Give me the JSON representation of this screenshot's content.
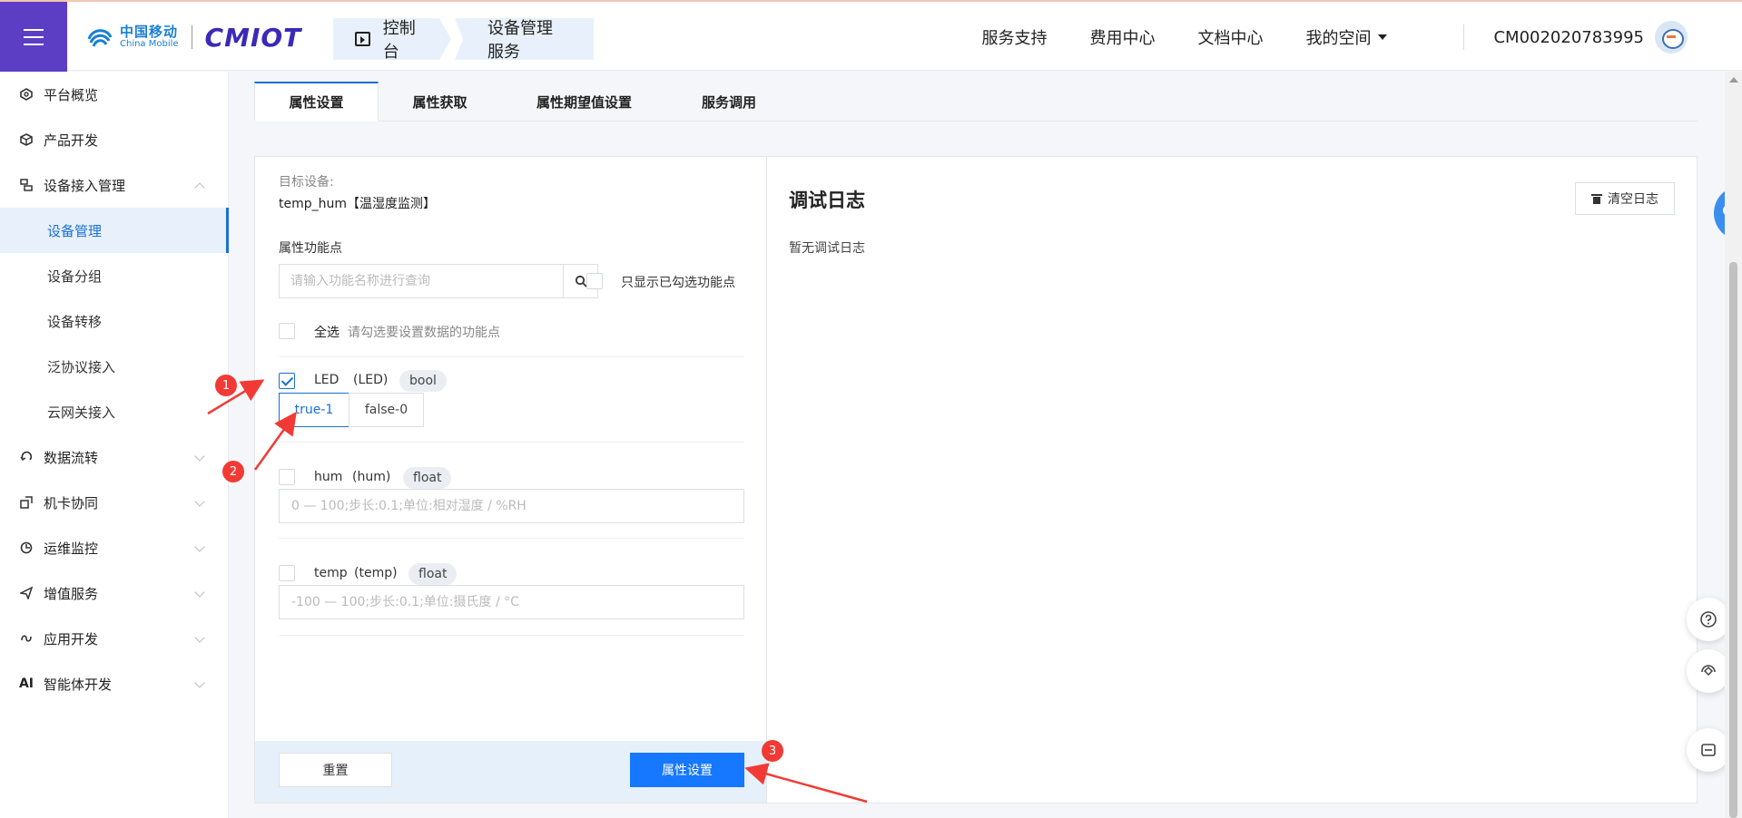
{
  "header": {
    "logo_cn": "中国移动",
    "logo_en": "China Mobile",
    "brand": "CMIOT",
    "crumbs": [
      "控制台",
      "设备管理服务"
    ],
    "nav": [
      "服务支持",
      "费用中心",
      "文档中心",
      "我的空间"
    ],
    "account": "CM002020783995"
  },
  "sidebar": {
    "items": [
      {
        "label": "平台概览",
        "icon": "overview-icon"
      },
      {
        "label": "产品开发",
        "icon": "cube-icon"
      },
      {
        "label": "设备接入管理",
        "icon": "device-access-icon"
      },
      {
        "label": "设备管理"
      },
      {
        "label": "设备分组"
      },
      {
        "label": "设备转移"
      },
      {
        "label": "泛协议接入"
      },
      {
        "label": "云网关接入"
      },
      {
        "label": "数据流转",
        "icon": "data-flow-icon"
      },
      {
        "label": "机卡协同",
        "icon": "sim-icon"
      },
      {
        "label": "运维监控",
        "icon": "monitor-icon"
      },
      {
        "label": "增值服务",
        "icon": "send-icon"
      },
      {
        "label": "应用开发",
        "icon": "app-icon"
      },
      {
        "label": "智能体开发",
        "icon": "ai-icon"
      }
    ]
  },
  "tabs": [
    "属性设置",
    "属性获取",
    "属性期望值设置",
    "服务调用"
  ],
  "form": {
    "target_label": "目标设备:",
    "target_value": "temp_hum【温湿度监测】",
    "props_label": "属性功能点",
    "search_placeholder": "请输入功能名称进行查询",
    "only_checked": "只显示已勾选功能点",
    "select_all": "全选",
    "select_hint": "请勾选要设置数据的功能点",
    "props": [
      {
        "name": "LED",
        "id": "(LED)",
        "type": "bool",
        "checked": true,
        "options": [
          "true-1",
          "false-0"
        ],
        "selected": "true-1"
      },
      {
        "name": "hum",
        "id": "(hum)",
        "type": "float",
        "checked": false,
        "placeholder": "0 — 100;步长:0.1;单位:相对湿度 / %RH"
      },
      {
        "name": "temp",
        "id": "(temp)",
        "type": "float",
        "checked": false,
        "placeholder": "-100 — 100;步长:0.1;单位:摄氏度 / °C"
      }
    ],
    "reset": "重置",
    "submit": "属性设置"
  },
  "log": {
    "title": "调试日志",
    "clear": "清空日志",
    "empty": "暂无调试日志"
  },
  "annotations": [
    "1",
    "2",
    "3"
  ],
  "colors": {
    "accent": "#1677ff",
    "menu": "#5b3ec4",
    "annotation": "#f23a35"
  }
}
